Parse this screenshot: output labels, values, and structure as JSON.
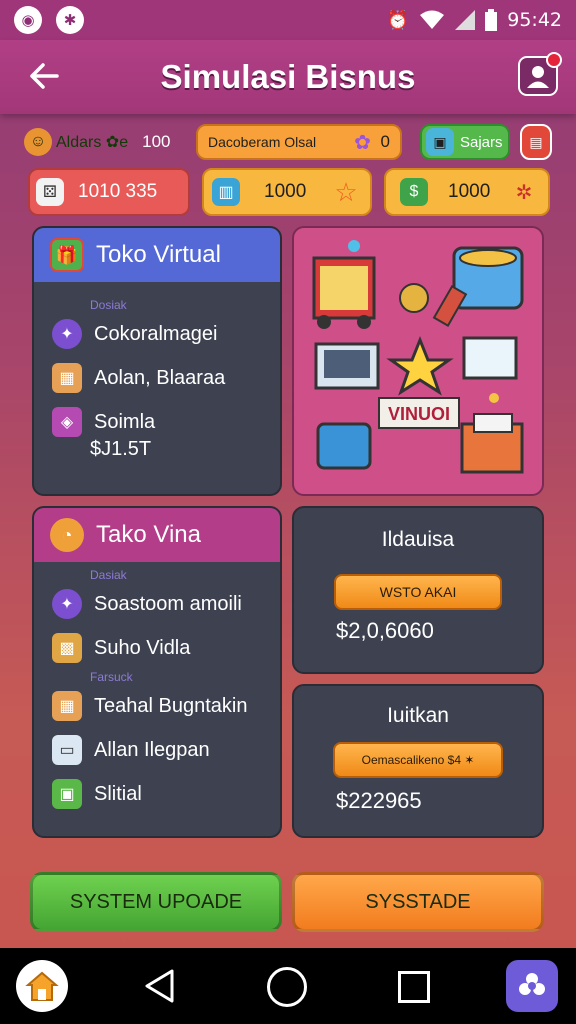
{
  "status_bar": {
    "time": "95:42",
    "icons": [
      "app-notification-icon",
      "star-notification-icon",
      "alarm-icon",
      "wifi-icon",
      "signal-icon",
      "battery-icon"
    ]
  },
  "app_bar": {
    "title": "Simulasi Bisnus",
    "back_icon": "arrow-left-icon",
    "profile_icon": "user-icon"
  },
  "resources": {
    "row1": [
      {
        "icon": "coin-icon",
        "label": "Aldars ✿e",
        "value": "100"
      },
      {
        "icon": "chip-icon",
        "label": "Dacoberam Olsal",
        "value": "0"
      },
      {
        "icon": "cube-icon",
        "label": "Sajars"
      },
      {
        "icon": "bag-icon",
        "label": ""
      }
    ],
    "row2": [
      {
        "icon": "dice-icon",
        "value": "1010 335"
      },
      {
        "icon": "box-icon",
        "value": "1000"
      },
      {
        "icon": "cash-icon",
        "value": "1000"
      }
    ]
  },
  "panel_toko_virtual": {
    "title": "Toko Virtual",
    "sub_label": "Dosiak",
    "items": [
      {
        "icon": "star-badge-icon",
        "label": "Cokoralmagei"
      },
      {
        "icon": "crate-icon",
        "label": "Aolan, Blaaraa"
      },
      {
        "icon": "gift-box-icon",
        "label": "Soimla"
      }
    ],
    "price": "$J1.5T"
  },
  "illustration": {
    "label": "VINUOI"
  },
  "panel_tako_vina": {
    "title": "Tako Vina",
    "sub_label_1": "Dasiak",
    "sub_label_2": "Farsuck",
    "items": [
      {
        "icon": "star-badge-icon",
        "label": "Soastoom amoili"
      },
      {
        "icon": "register-icon",
        "label": "Suho Vidla"
      },
      {
        "icon": "crate-icon",
        "label": "Teahal Bugntakin"
      },
      {
        "icon": "card-icon",
        "label": "Allan Ilegpan"
      },
      {
        "icon": "basket-icon",
        "label": "Slitial"
      }
    ]
  },
  "stat_1": {
    "title": "Ildauisa",
    "button": "WSTO AKAI",
    "value": "$2,0,6060"
  },
  "stat_2": {
    "title": "Iuitkan",
    "button": "Oemascalikeno  $4 ✶",
    "value": "$222965"
  },
  "actions": {
    "left": "SYSTEM UPOADE",
    "right": "SYSSTADE"
  },
  "colors": {
    "bg_top": "#8e3a78",
    "bg_bottom": "#c9554f",
    "panel": "#3e4250",
    "green": "#5fc040",
    "orange": "#f8902a"
  }
}
